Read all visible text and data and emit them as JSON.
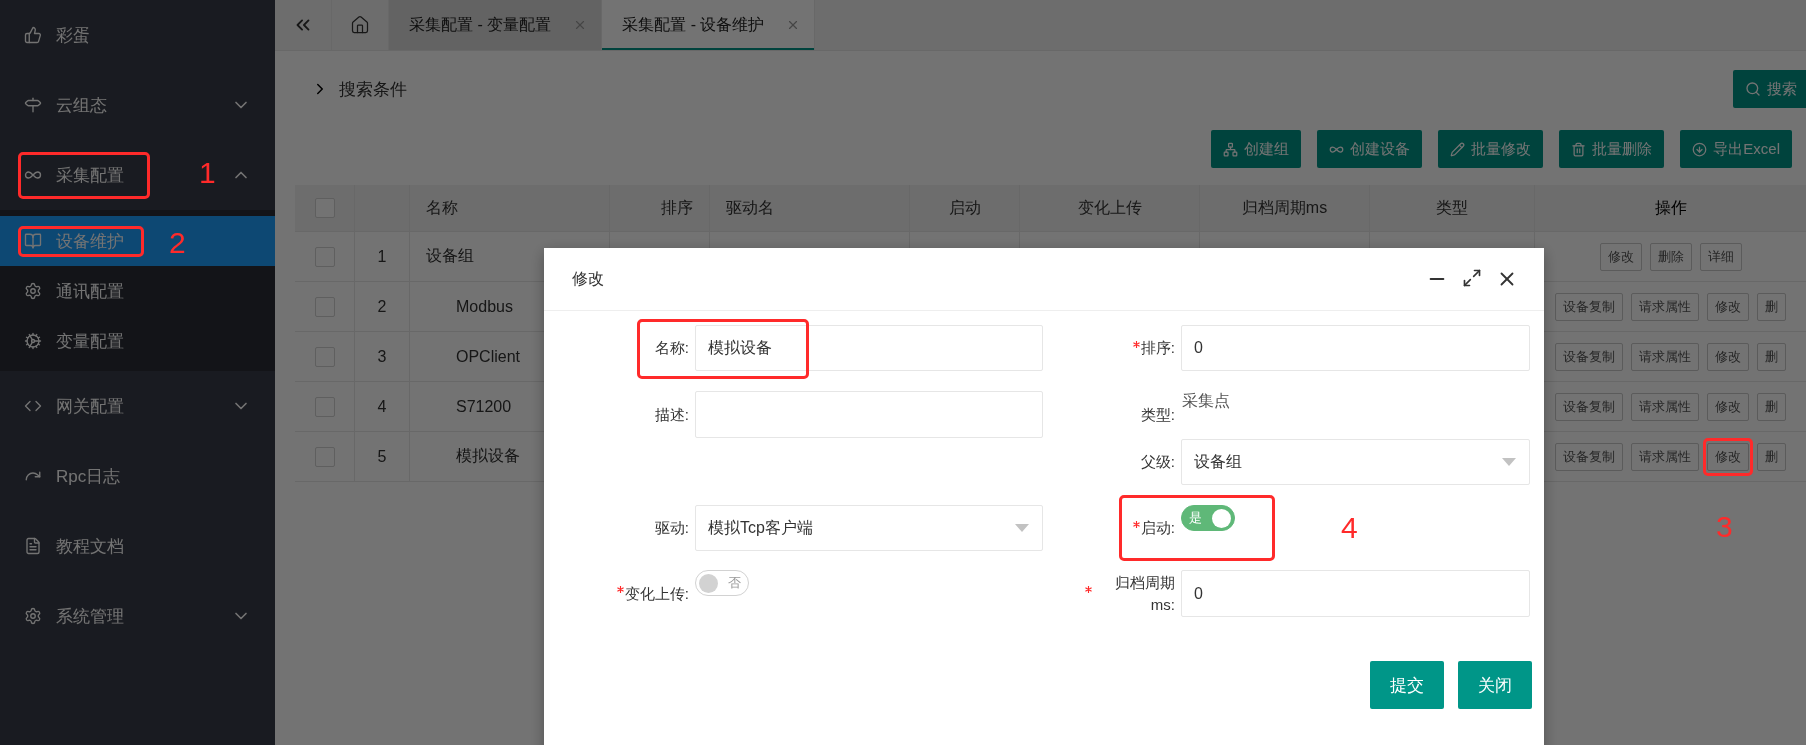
{
  "sidebar": {
    "items": [
      {
        "label": "彩蛋"
      },
      {
        "label": "云组态",
        "expanded": false
      },
      {
        "label": "采集配置",
        "expanded": true,
        "highlighted": true,
        "annotation": "1",
        "children": [
          {
            "label": "设备维护",
            "selected": true,
            "highlighted": true,
            "annotation": "2"
          },
          {
            "label": "通讯配置",
            "selected": false
          },
          {
            "label": "变量配置",
            "selected": false
          }
        ]
      },
      {
        "label": "网关配置",
        "expanded": false
      },
      {
        "label": "Rpc日志"
      },
      {
        "label": "教程文档"
      },
      {
        "label": "系统管理",
        "expanded": false
      }
    ]
  },
  "tabs": [
    {
      "label": "采集配置 - 变量配置",
      "selected": false
    },
    {
      "label": "采集配置 - 设备维护",
      "selected": true
    }
  ],
  "search": {
    "label": "搜索条件",
    "button": "搜索"
  },
  "toolbar": [
    "创建组",
    "创建设备",
    "批量修改",
    "批量删除",
    "导出Excel"
  ],
  "table": {
    "header_checked": false,
    "columns": [
      "名称",
      "排序",
      "驱动名",
      "启动",
      "变化上传",
      "归档周期ms",
      "类型",
      "操作"
    ],
    "rows": [
      {
        "index": "1",
        "name": "设备组",
        "checked": false,
        "actions": [
          {
            "label": "修改"
          },
          {
            "label": "删除"
          },
          {
            "label": "详细"
          }
        ],
        "children": [
          {
            "index": "2",
            "name": "Modbus",
            "checked": false,
            "actions": [
              {
                "label": "设备复制"
              },
              {
                "label": "请求属性"
              },
              {
                "label": "修改"
              },
              {
                "label": "删"
              }
            ]
          },
          {
            "index": "3",
            "name": "OPClient",
            "checked": false,
            "actions": [
              {
                "label": "设备复制"
              },
              {
                "label": "请求属性"
              },
              {
                "label": "修改"
              },
              {
                "label": "删"
              }
            ]
          },
          {
            "index": "4",
            "name": "S71200",
            "checked": false,
            "actions": [
              {
                "label": "设备复制"
              },
              {
                "label": "请求属性"
              },
              {
                "label": "修改"
              },
              {
                "label": "删"
              }
            ]
          },
          {
            "index": "5",
            "name": "模拟设备",
            "checked": false,
            "actions": [
              {
                "label": "设备复制"
              },
              {
                "label": "请求属性"
              },
              {
                "label": "修改",
                "highlighted": true,
                "annotation": "3"
              },
              {
                "label": "删"
              }
            ]
          }
        ]
      }
    ]
  },
  "dialog": {
    "title": "修改",
    "rows": [
      {
        "left": {
          "kind": "input",
          "label": "名称:",
          "required": false,
          "value": "模拟设备",
          "highlighted": true
        },
        "right": {
          "kind": "input",
          "label": "排序:",
          "required": true,
          "value": "0"
        }
      },
      {
        "left": {
          "kind": "input",
          "label": "描述:",
          "required": false
        },
        "right": {
          "kind": "text",
          "label": "类型:",
          "required": false,
          "value": "采集点"
        }
      },
      {
        "right": {
          "kind": "select",
          "label": "父级:",
          "required": false,
          "value": "设备组"
        }
      },
      {
        "left": {
          "kind": "select",
          "label": "驱动:",
          "required": false,
          "value": "模拟Tcp客户端"
        },
        "right": {
          "kind": "switch",
          "label": "启动:",
          "required": true,
          "on": true,
          "value": "是",
          "highlighted": true,
          "annotation": "4"
        }
      },
      {
        "left": {
          "kind": "switch",
          "label": "变化上传:",
          "required": true,
          "on": false,
          "value": "否"
        },
        "right": {
          "kind": "input",
          "label": "归档周期ms:",
          "required": true,
          "value": "0"
        }
      }
    ],
    "buttons": [
      "提交",
      "关闭"
    ]
  }
}
